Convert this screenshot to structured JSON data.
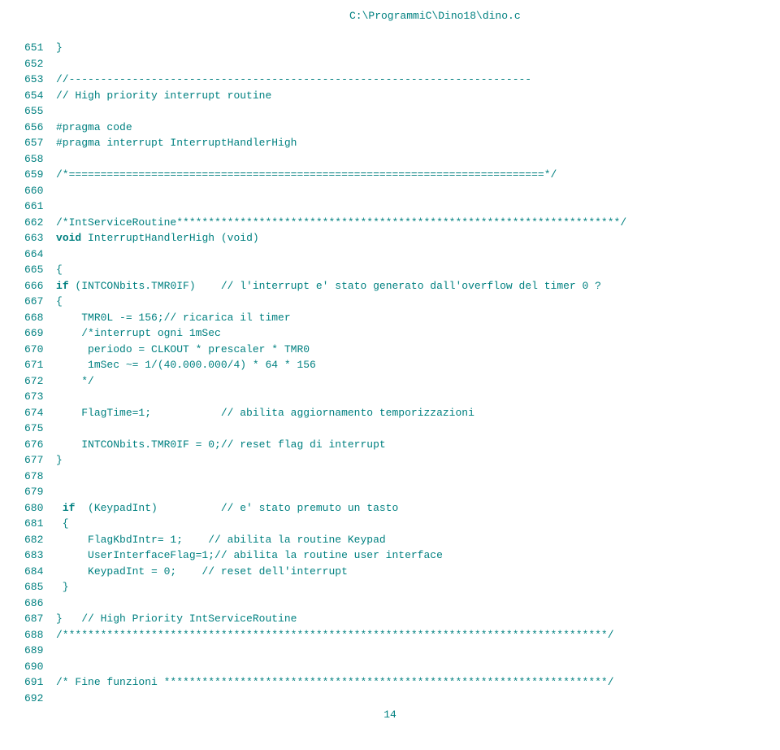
{
  "header": {
    "filepath": "C:\\ProgrammiC\\Dino18\\dino.c"
  },
  "code": {
    "lines": [
      {
        "n": "651",
        "pre": "",
        "t": "}"
      },
      {
        "n": "652",
        "pre": "",
        "t": ""
      },
      {
        "n": "653",
        "pre": "",
        "t": "//-------------------------------------------------------------------------"
      },
      {
        "n": "654",
        "pre": "",
        "t": "// High priority interrupt routine"
      },
      {
        "n": "655",
        "pre": "",
        "t": ""
      },
      {
        "n": "656",
        "pre": "",
        "t": "#pragma code"
      },
      {
        "n": "657",
        "pre": "",
        "t": "#pragma interrupt InterruptHandlerHigh"
      },
      {
        "n": "658",
        "pre": "",
        "t": ""
      },
      {
        "n": "659",
        "pre": "",
        "t": "/*===========================================================================*/"
      },
      {
        "n": "660",
        "pre": "",
        "t": ""
      },
      {
        "n": "661",
        "pre": "",
        "t": ""
      },
      {
        "n": "662",
        "pre": "",
        "t": "/*IntServiceRoutine**********************************************************************/"
      },
      {
        "n": "663",
        "pre": "void",
        "t": " InterruptHandlerHigh (void)"
      },
      {
        "n": "664",
        "pre": "",
        "t": ""
      },
      {
        "n": "665",
        "pre": "",
        "t": "{"
      },
      {
        "n": "666",
        "pre": "if",
        "t": " (INTCONbits.TMR0IF)    // l'interrupt e' stato generato dall'overflow del timer 0 ?"
      },
      {
        "n": "667",
        "pre": "",
        "t": "{"
      },
      {
        "n": "668",
        "pre": "",
        "t": "    TMR0L -= 156;// ricarica il timer"
      },
      {
        "n": "669",
        "pre": "",
        "t": "    /*interrupt ogni 1mSec"
      },
      {
        "n": "670",
        "pre": "",
        "t": "     periodo = CLKOUT * prescaler * TMR0"
      },
      {
        "n": "671",
        "pre": "",
        "t": "     1mSec ~= 1/(40.000.000/4) * 64 * 156"
      },
      {
        "n": "672",
        "pre": "",
        "t": "    */"
      },
      {
        "n": "673",
        "pre": "",
        "t": ""
      },
      {
        "n": "674",
        "pre": "",
        "t": "    FlagTime=1;           // abilita aggiornamento temporizzazioni"
      },
      {
        "n": "675",
        "pre": "",
        "t": ""
      },
      {
        "n": "676",
        "pre": "",
        "t": "    INTCONbits.TMR0IF = 0;// reset flag di interrupt"
      },
      {
        "n": "677",
        "pre": "",
        "t": "}"
      },
      {
        "n": "678",
        "pre": "",
        "t": ""
      },
      {
        "n": "679",
        "pre": "",
        "t": ""
      },
      {
        "n": "680",
        "pre": " if",
        "t": "  (KeypadInt)          // e' stato premuto un tasto"
      },
      {
        "n": "681",
        "pre": "",
        "t": " {"
      },
      {
        "n": "682",
        "pre": "",
        "t": "     FlagKbdIntr= 1;    // abilita la routine Keypad"
      },
      {
        "n": "683",
        "pre": "",
        "t": "     UserInterfaceFlag=1;// abilita la routine user interface"
      },
      {
        "n": "684",
        "pre": "",
        "t": "     KeypadInt = 0;    // reset dell'interrupt"
      },
      {
        "n": "685",
        "pre": "",
        "t": " }"
      },
      {
        "n": "686",
        "pre": "",
        "t": ""
      },
      {
        "n": "687",
        "pre": "",
        "t": "}   // High Priority IntServiceRoutine"
      },
      {
        "n": "688",
        "pre": "",
        "t": "/**************************************************************************************/"
      },
      {
        "n": "689",
        "pre": "",
        "t": ""
      },
      {
        "n": "690",
        "pre": "",
        "t": ""
      },
      {
        "n": "691",
        "pre": "",
        "t": "/* Fine funzioni **********************************************************************/"
      },
      {
        "n": "692",
        "pre": "",
        "t": ""
      }
    ]
  },
  "footer": {
    "pagenum": "14"
  }
}
